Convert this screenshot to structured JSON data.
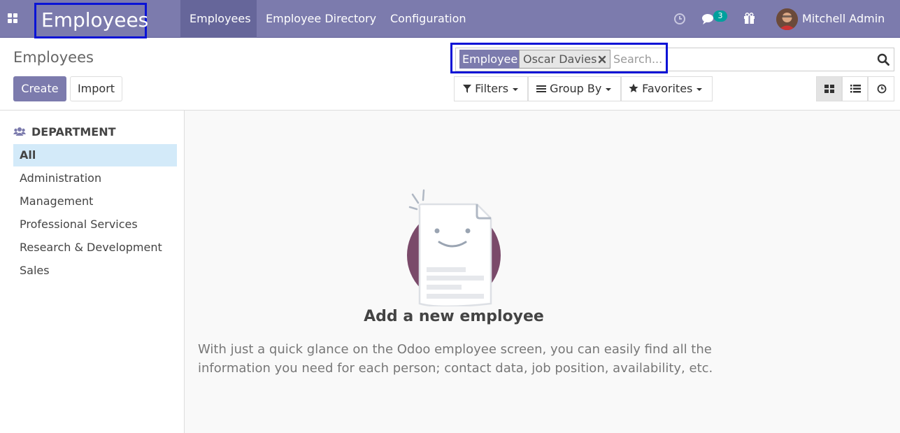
{
  "navbar": {
    "apps_icon": "grid-icon",
    "app_title": "Employees",
    "menu": [
      {
        "label": "Employees",
        "active": true
      },
      {
        "label": "Employee Directory",
        "active": false
      },
      {
        "label": "Configuration",
        "active": false
      }
    ],
    "activity_icon": "clock-icon",
    "messages_icon": "chat-icon",
    "messages_count": "3",
    "gift_icon": "gift-icon",
    "user_name": "Mitchell Admin"
  },
  "control_panel": {
    "breadcrumb": "Employees",
    "create_label": "Create",
    "import_label": "Import",
    "search": {
      "facet_label": "Employee",
      "facet_value": "Oscar Davies",
      "placeholder": "Search..."
    },
    "filters_label": "Filters",
    "group_by_label": "Group By",
    "favorites_label": "Favorites",
    "views": [
      "kanban",
      "list",
      "activity"
    ]
  },
  "sidebar": {
    "header": "DEPARTMENT",
    "items": [
      {
        "label": "All",
        "active": true
      },
      {
        "label": "Administration",
        "active": false
      },
      {
        "label": "Management",
        "active": false
      },
      {
        "label": "Professional Services",
        "active": false
      },
      {
        "label": "Research & Development",
        "active": false
      },
      {
        "label": "Sales",
        "active": false
      }
    ]
  },
  "empty_state": {
    "title": "Add a new employee",
    "line1": "With just a quick glance on the Odoo employee screen, you can easily find all the",
    "line2": "information you need for each person; contact data, job position, availability, etc."
  },
  "colors": {
    "brand": "#7c7bad",
    "highlight_box": "#0a13d6",
    "badge": "#00a09d",
    "sidebar_active": "#d3eaf9"
  }
}
